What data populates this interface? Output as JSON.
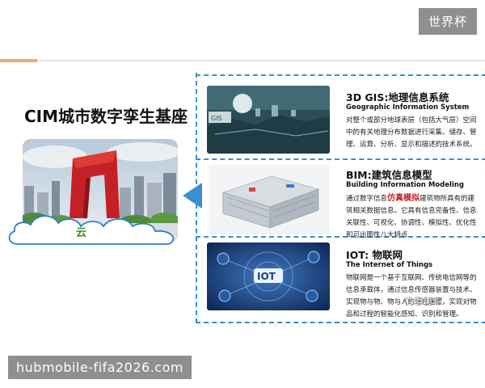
{
  "badge": "世界杯",
  "main_title": "CIM城市数字孪生基座",
  "cloud_label": "云",
  "sections": [
    {
      "title": "3D GIS:地理信息系统",
      "subtitle": "Geographic Information System",
      "body": "对整个或部分地球表层（包括大气层）空间中的有关地理分布数据进行采集、储存、管理、运算、分析、显示和描述的技术系统。",
      "image_label": "GIS"
    },
    {
      "title": "BIM:建筑信息模型",
      "subtitle": "Building Information Modeling",
      "body_prefix": "通过数字信息",
      "body_highlight": "仿真模拟",
      "body_suffix": "建筑物所具有的建筑相关数据信息。它具有信息完备性、信息关联性、可视化、协调性、模拟性、优化性和可出图性八大特点"
    },
    {
      "title": "IOT: 物联网",
      "subtitle": "The Internet of Things",
      "body": "物联网是一个基于互联网、传统电信网等的信息承载体，通过信息传感器装置与技术、实现物与物、物与人的泛在连接，实现对物品和过程的智能化感知、识别和管理。",
      "image_label": "IOT"
    }
  ],
  "watermark": "优享智库",
  "url_banner": "hubmobile-fifa2026.com",
  "colors": {
    "accent_orange": "#f0a875",
    "dashed_blue": "#3a8fcf",
    "highlight_red": "#c4262e",
    "cloud_green": "#3a8a2e",
    "badge_gray": "#8f8f8f"
  }
}
